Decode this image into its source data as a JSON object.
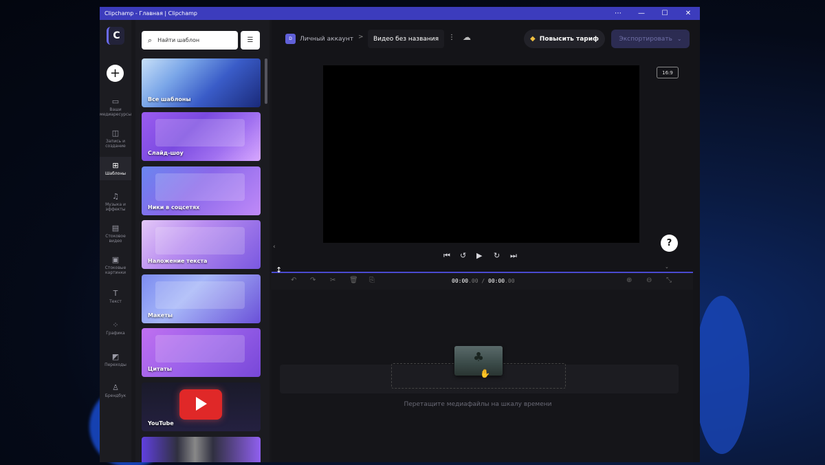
{
  "window": {
    "title": "Clipchamp - Главная | Clipchamp",
    "controls": [
      "⋯",
      "—",
      "☐",
      "✕"
    ]
  },
  "rail": {
    "logo": "C",
    "add": "+",
    "items": [
      {
        "icon": "folder-icon",
        "glyph": "▭",
        "label": "Ваши медиаресурсы"
      },
      {
        "icon": "record-icon",
        "glyph": "◫",
        "label": "Запись и создание"
      },
      {
        "icon": "templates-icon",
        "glyph": "⊞",
        "label": "Шаблоны"
      },
      {
        "icon": "music-icon",
        "glyph": "♫",
        "label": "Музыка и эффекты"
      },
      {
        "icon": "stock-video-icon",
        "glyph": "▤",
        "label": "Стоковое видео"
      },
      {
        "icon": "stock-image-icon",
        "glyph": "▣",
        "label": "Стоковые картинки"
      },
      {
        "icon": "text-icon",
        "glyph": "T",
        "label": "Текст"
      },
      {
        "icon": "graphics-icon",
        "glyph": "⁘",
        "label": "Графика"
      },
      {
        "icon": "transitions-icon",
        "glyph": "◩",
        "label": "Переходы"
      },
      {
        "icon": "brand-kit-icon",
        "glyph": "♙",
        "label": "Брендбук"
      }
    ]
  },
  "panel": {
    "search_placeholder": "Найти шаблон",
    "cards": [
      {
        "label": "Все шаблоны"
      },
      {
        "label": "Слайд-шоу"
      },
      {
        "label": "Ники в соцсетях"
      },
      {
        "label": "Наложение текста"
      },
      {
        "label": "Макеты"
      },
      {
        "label": "Цитаты"
      },
      {
        "label": "YouTube"
      }
    ]
  },
  "topbar": {
    "account_initial": "D",
    "account": "Личный аккаунт",
    "sep": ">",
    "video_title": "Видео без названия",
    "upgrade": "Повысить тариф",
    "export": "Экспортировать"
  },
  "preview": {
    "aspect_ratio": "16:9",
    "help": "?"
  },
  "timeline": {
    "time_current": "00:00",
    "time_current_ms": ".00",
    "time_sep": " / ",
    "time_total": "00:00",
    "time_total_ms": ".00",
    "drop_hint": "Перетащите медиафайлы на шкалу времени"
  },
  "colors": {
    "accent": "#3c3cbd",
    "export_bg": "#2c2c52",
    "timeline_line": "#4a4ad0"
  }
}
